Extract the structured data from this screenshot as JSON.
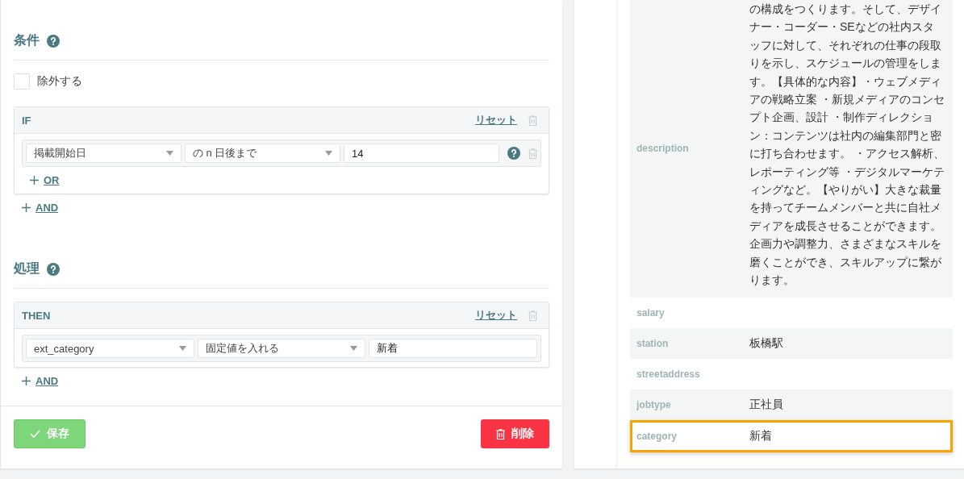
{
  "conditions": {
    "title": "条件",
    "exclude": {
      "label": "除外する",
      "checked": false
    },
    "block": {
      "label": "IF",
      "reset": "リセット",
      "rules": [
        {
          "field": "掲載開始日",
          "operator": "の n 日後まで",
          "value": "14",
          "help": true,
          "removable": true
        }
      ],
      "or_link": "OR"
    },
    "and_link": "AND"
  },
  "actions": {
    "title": "処理",
    "block": {
      "label": "THEN",
      "reset": "リセット",
      "rules": [
        {
          "field": "ext_category",
          "operator": "固定値を入れる",
          "value": "新着",
          "help": false,
          "removable": false
        }
      ]
    },
    "and_link": "AND"
  },
  "buttons": [
    {
      "kind": "save",
      "label": "保存"
    },
    {
      "kind": "delete",
      "label": "削除"
    }
  ],
  "record": {
    "rows": [
      {
        "key": "description",
        "value": "の構成をつくります。そして、デザイナー・コーダー・SEなどの社内スタッフに対して、それぞれの仕事の段取りを示し、スケジュールの管理をします。【具体的な内容】・ウェブメディアの戦略立案 ・新規メディアのコンセプト企画、設計 ・制作ディレクション：コンテンツは社内の編集部門と密に打ち合わせます。 ・アクセス解析、レポーティング等 ・デジタルマーケティングなど。【やりがい】大きな裁量を持ってチームメンバーと共に自社メディアを成長させることができます。企画力や調整力、さまざまなスキルを磨くことができ、スキルアップに繋がります。",
        "highlighted": false
      },
      {
        "key": "salary",
        "highlighted": false
      },
      {
        "key": "station",
        "value": "板橋駅",
        "highlighted": false
      },
      {
        "key": "streetaddress",
        "highlighted": false
      },
      {
        "key": "jobtype",
        "value": "正社員",
        "highlighted": false
      },
      {
        "key": "category",
        "value": "新着",
        "highlighted": true
      }
    ]
  }
}
